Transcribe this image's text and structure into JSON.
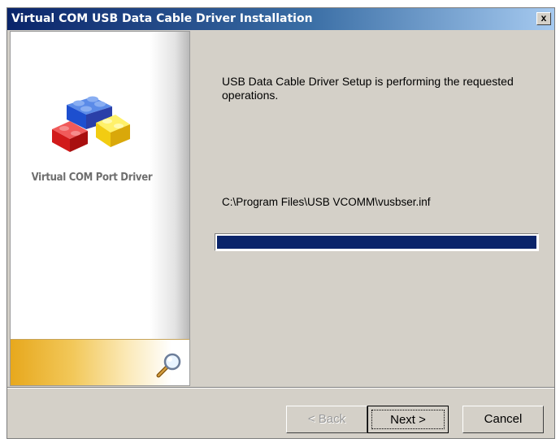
{
  "window": {
    "title": "Virtual COM USB Data Cable Driver Installation",
    "close_label": "x"
  },
  "left_panel": {
    "product_name": "Virtual COM Port Driver",
    "logo_icon": "lego-bricks-icon",
    "search_icon": "magnifier-icon"
  },
  "content": {
    "status_text": "USB Data Cable Driver Setup is performing the requested operations.",
    "file_path": "C:\\Program Files\\USB VCOMM\\vusbser.inf",
    "progress": 1.0
  },
  "buttons": {
    "back_label": "< Back",
    "next_label": "Next >",
    "cancel_label": "Cancel"
  },
  "colors": {
    "titlebar_start": "#0a246a",
    "titlebar_end": "#a6caf0",
    "progress_fill": "#0a246a",
    "dialog_bg": "#d4d0c8"
  }
}
